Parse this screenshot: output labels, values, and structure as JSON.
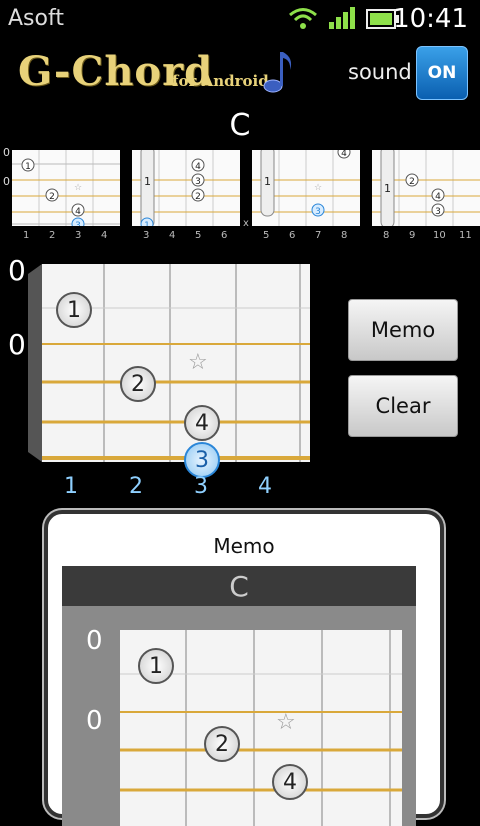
{
  "status_bar": {
    "carrier": "Asoft",
    "time": "10:41"
  },
  "header": {
    "logo_main": "G-Chord",
    "logo_sub": "for Android",
    "sound_label": "sound",
    "sound_toggle": "ON"
  },
  "chord": {
    "name": "C"
  },
  "thumbnails": [
    {
      "start_marks": [
        "0",
        "0"
      ],
      "frets": [
        "1",
        "2",
        "3",
        "4"
      ],
      "barre": false,
      "side_mark": ""
    },
    {
      "start_marks": [
        "",
        "1"
      ],
      "frets": [
        "3",
        "4",
        "5",
        "6"
      ],
      "barre": true,
      "side_mark": "x"
    },
    {
      "start_marks": [
        "",
        "1"
      ],
      "frets": [
        "5",
        "6",
        "7",
        "8"
      ],
      "barre": true,
      "side_mark": ""
    },
    {
      "start_marks": [
        "",
        "1"
      ],
      "frets": [
        "8",
        "9",
        "10",
        "11"
      ],
      "barre": true,
      "side_mark": ""
    }
  ],
  "fretboard": {
    "open_marks": [
      "0",
      "0"
    ],
    "frets": [
      "1",
      "2",
      "3",
      "4"
    ],
    "fingers": [
      "1",
      "2",
      "4",
      "3"
    ],
    "star": "☆"
  },
  "buttons": {
    "memo": "Memo",
    "clear": "Clear"
  },
  "memo": {
    "title": "Memo",
    "chord": "C",
    "open_marks": [
      "0",
      "0"
    ],
    "fingers": [
      "1",
      "2",
      "4"
    ],
    "star": "☆"
  },
  "colors": {
    "accent_blue": "#2a86d8",
    "string_gold": "#d9a83a",
    "logo_gold": "#e8d27a"
  }
}
